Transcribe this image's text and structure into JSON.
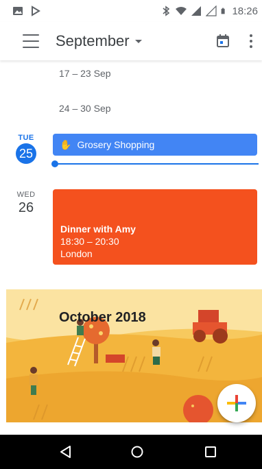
{
  "status_bar": {
    "time": "18:26",
    "icons": [
      "gallery-notification-icon",
      "play-store-notification-icon",
      "bluetooth-icon",
      "wifi-icon",
      "signal-icon",
      "battery-icon"
    ]
  },
  "app_bar": {
    "month_label": "September",
    "icons": [
      "menu-icon",
      "dropdown-caret-icon",
      "today-calendar-icon",
      "more-vert-icon"
    ]
  },
  "weeks": [
    {
      "label": "17 – 23 Sep"
    },
    {
      "label": "24 – 30 Sep"
    }
  ],
  "days": [
    {
      "dow": "TUE",
      "day": "25",
      "is_today": true,
      "events": [
        {
          "title": "Grosery Shopping",
          "icon": "hand-icon",
          "color": "#4285f4"
        }
      ]
    },
    {
      "dow": "WED",
      "day": "26",
      "is_today": false,
      "events": [
        {
          "title": "Dinner with Amy",
          "time": "18:30 – 20:30",
          "location": "London",
          "color": "#f4511e"
        }
      ]
    }
  ],
  "month_banner": {
    "title": "October 2018"
  },
  "fab": {
    "icon": "add-icon",
    "colors": [
      "#ea4335",
      "#4285f4",
      "#34a853",
      "#fbbc04"
    ]
  },
  "nav_bar": {
    "icons": [
      "back-icon",
      "home-icon",
      "recents-icon"
    ]
  },
  "colors": {
    "accent": "#1a73e8",
    "event_blue": "#4285f4",
    "event_orange": "#f4511e"
  }
}
